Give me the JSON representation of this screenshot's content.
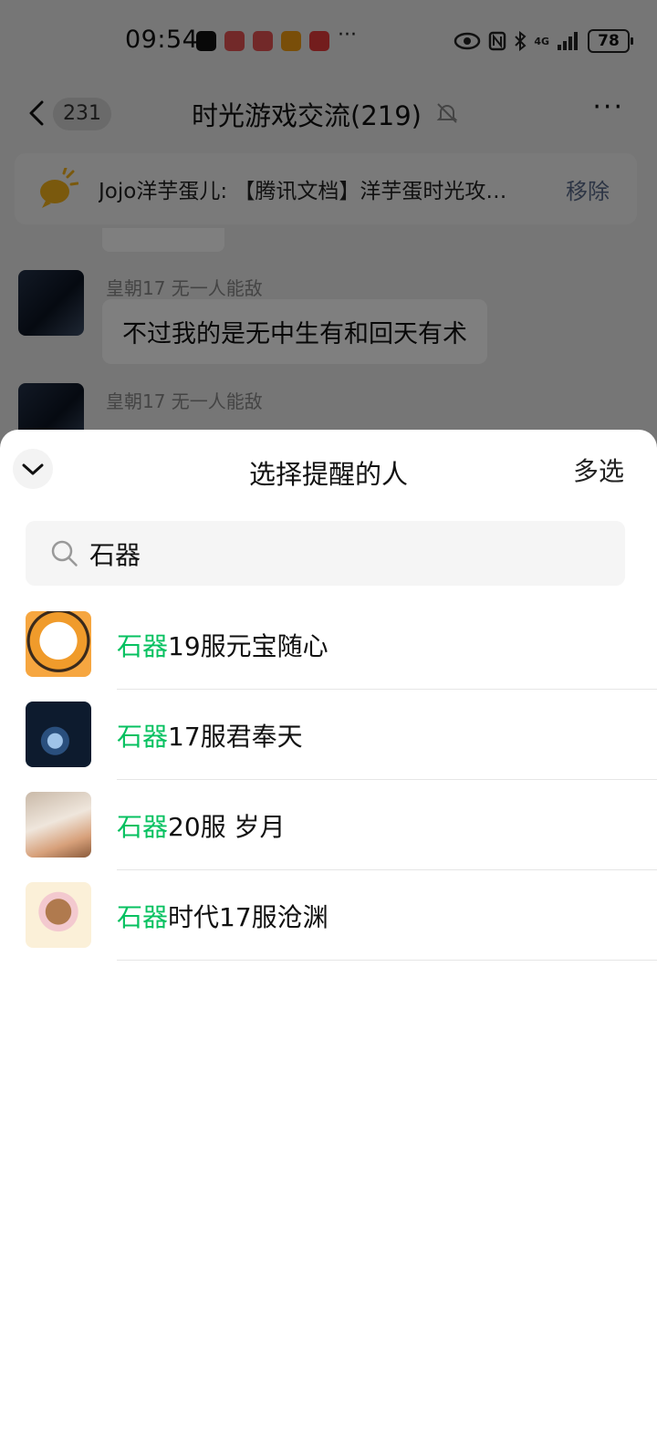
{
  "status_bar": {
    "time": "09:54",
    "app_icons": [
      "tiktok-icon",
      "reader-icon",
      "reader-icon",
      "taobao-icon",
      "pinduoduo-icon"
    ],
    "more": "···",
    "battery": "78",
    "network": "4G"
  },
  "chat": {
    "back_count": "231",
    "title": "时光游戏交流(219)",
    "more": "···",
    "notice": {
      "text": "Jojo洋芋蛋儿: 【腾讯文档】洋芋蛋时光攻…",
      "remove_label": "移除"
    },
    "messages": [
      {
        "name": "皇朝17   无一人能敌",
        "text": "不过我的是无中生有和回天有术"
      },
      {
        "name": "皇朝17   无一人能敌",
        "text": ""
      }
    ]
  },
  "sheet": {
    "title": "选择提醒的人",
    "multi_select_label": "多选",
    "search": {
      "value": "石器",
      "placeholder": "搜索"
    },
    "results": [
      {
        "highlight": "石器",
        "rest": "19服元宝随心"
      },
      {
        "highlight": "石器",
        "rest": "17服君奉天"
      },
      {
        "highlight": "石器",
        "rest": "20服 岁月"
      },
      {
        "highlight": "石器",
        "rest": "时代17服沧渊"
      }
    ]
  },
  "colors": {
    "highlight": "#07c160",
    "link": "#5a6b8a"
  }
}
